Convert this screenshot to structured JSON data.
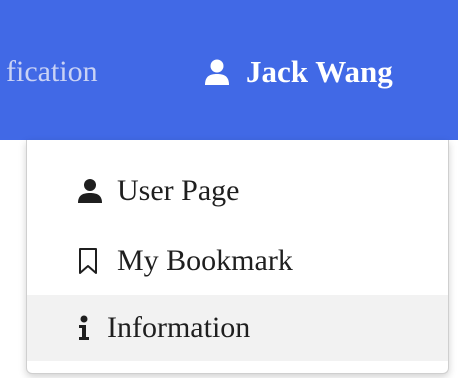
{
  "navbar": {
    "truncated_item_label": "fication",
    "user_icon": "user-icon",
    "user_name": "Jack Wang",
    "background_color": "#4169e6"
  },
  "dropdown": {
    "items": [
      {
        "label": "User Page",
        "icon": "user-icon",
        "active": false
      },
      {
        "label": "My Bookmark",
        "icon": "bookmark-outline-icon",
        "active": false
      },
      {
        "label": "Information",
        "icon": "info-icon",
        "active": true
      }
    ],
    "hover_background": "#f2f2f2"
  }
}
